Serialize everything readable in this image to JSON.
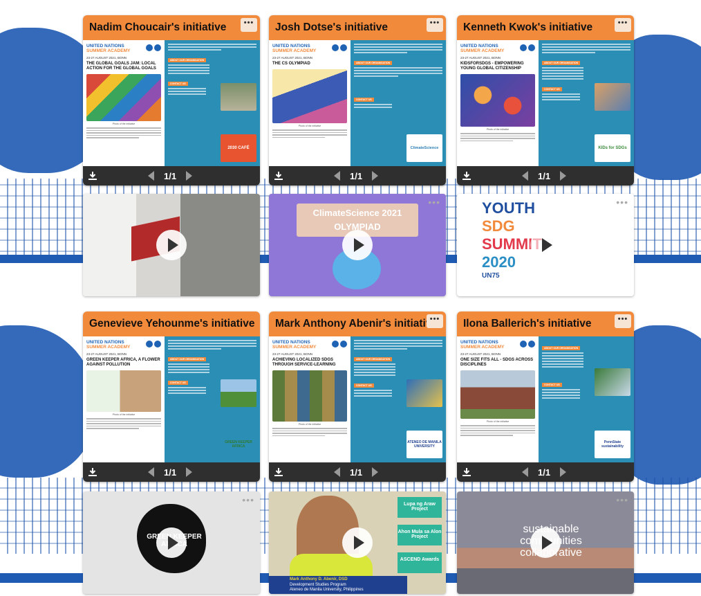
{
  "cards": [
    {
      "title": "Nadim Choucair's initiative",
      "org_line1": "UNITED NATIONS",
      "org_line2": "SUMMER ACADEMY",
      "date": "23-27 AUGUST 2021, BONN",
      "headline": "THE GLOBAL GOALS JAM: LOCAL ACTION FOR THE GLOBAL GOALS",
      "photo_caption": "Photo of the initiative",
      "about_tag": "ABOUT OUR ORGANISATION",
      "contact_tag": "CONTACT US",
      "org_logo_text": "2030 CAFÉ",
      "page": "1/1"
    },
    {
      "title": "Josh Dotse's initiative",
      "org_line1": "UNITED NATIONS",
      "org_line2": "SUMMER ACADEMY",
      "date": "23-27 AUGUST 2021, BONN",
      "headline": "THE CS OLYMPIAD",
      "photo_caption": "Photo of the initiative",
      "about_tag": "ABOUT OUR ORGANISATION",
      "contact_tag": "CONTACT US",
      "org_logo_text": "ClimateScience",
      "page": "1/1"
    },
    {
      "title": "Kenneth Kwok's initiative",
      "org_line1": "UNITED NATIONS",
      "org_line2": "SUMMER ACADEMY",
      "date": "23-27 AUGUST 2021, BONN",
      "headline": "KIDSFORSDGS - EMPOWERING YOUNG GLOBAL CITIZENSHIP",
      "photo_caption": "Photo of the initiative",
      "about_tag": "ABOUT OUR ORGANISATION",
      "contact_tag": "CONTACT US",
      "org_logo_text": "KIDs for SDGs",
      "page": "1/1"
    },
    {
      "title": "Genevieve Yehounme's initiative",
      "org_line1": "UNITED NATIONS",
      "org_line2": "SUMMER ACADEMY",
      "date": "23-27 AUGUST 2021, BONN",
      "headline": "GREEN KEEPER AFRICA, A FLOWER AGAINST POLLUTION",
      "photo_caption": "Photo of the initiative",
      "about_tag": "ABOUT OUR ORGANISATION",
      "contact_tag": "CONTACT US",
      "org_logo_text": "GREEN KEEPER AFRICA",
      "page": "1/1"
    },
    {
      "title": "Mark Anthony Abenir's initiative",
      "org_line1": "UNITED NATIONS",
      "org_line2": "SUMMER ACADEMY",
      "date": "23-27 AUGUST 2021, BONN",
      "headline": "ACHIEVING LOCALIZED SDGS THROUGH SERVICE-LEARNING",
      "photo_caption": "Photo of the initiative",
      "about_tag": "ABOUT OUR ORGANISATION",
      "contact_tag": "CONTACT US",
      "org_logo_text": "ATENEO DE MANILA UNIVERSITY",
      "page": "1/1"
    },
    {
      "title": "Ilona Ballerich's initiative",
      "org_line1": "UNITED NATIONS",
      "org_line2": "SUMMER ACADEMY",
      "date": "23-27 AUGUST 2021, BONN",
      "headline": "ONE SIZE FITS ALL - SDGS ACROSS DISCIPLINES",
      "photo_caption": "Photo of the initiative",
      "about_tag": "ABOUT OUR ORGANISATION",
      "contact_tag": "CONTACT US",
      "org_logo_text": "PennState sustainability",
      "page": "1/1"
    }
  ],
  "videos": [
    {
      "caption": ""
    },
    {
      "caption": "ClimateScience 2021 OLYMPIAD"
    },
    {
      "caption_line1": "YOUTH",
      "caption_line2": "SDG",
      "caption_line3": "SUMMIT",
      "caption_line4": "2020",
      "caption_line5": "UN75"
    },
    {
      "caption": "GREEN KEEPER AFRICA"
    },
    {
      "name_line": "Mark Anthony D. Abenir, DSD",
      "program_line": "Development Studies Program",
      "uni_line": "Ateneo de Manila University, Philippines",
      "side1": "Lupa ng Araw Project",
      "side2": "Ahon Mula sa Alon Project",
      "side3": "ASCEND Awards"
    },
    {
      "caption_line1": "sustainable",
      "caption_line2": "communities",
      "caption_line3": "collaborative"
    }
  ],
  "ui": {
    "more_glyph": "•••",
    "dots_glyph": "•••"
  },
  "colors": {
    "accent_orange": "#f28a3c",
    "panel_blue": "#2b8fb5",
    "footer_dark": "#2f2f2f",
    "brand_blue": "#1f63b5"
  }
}
